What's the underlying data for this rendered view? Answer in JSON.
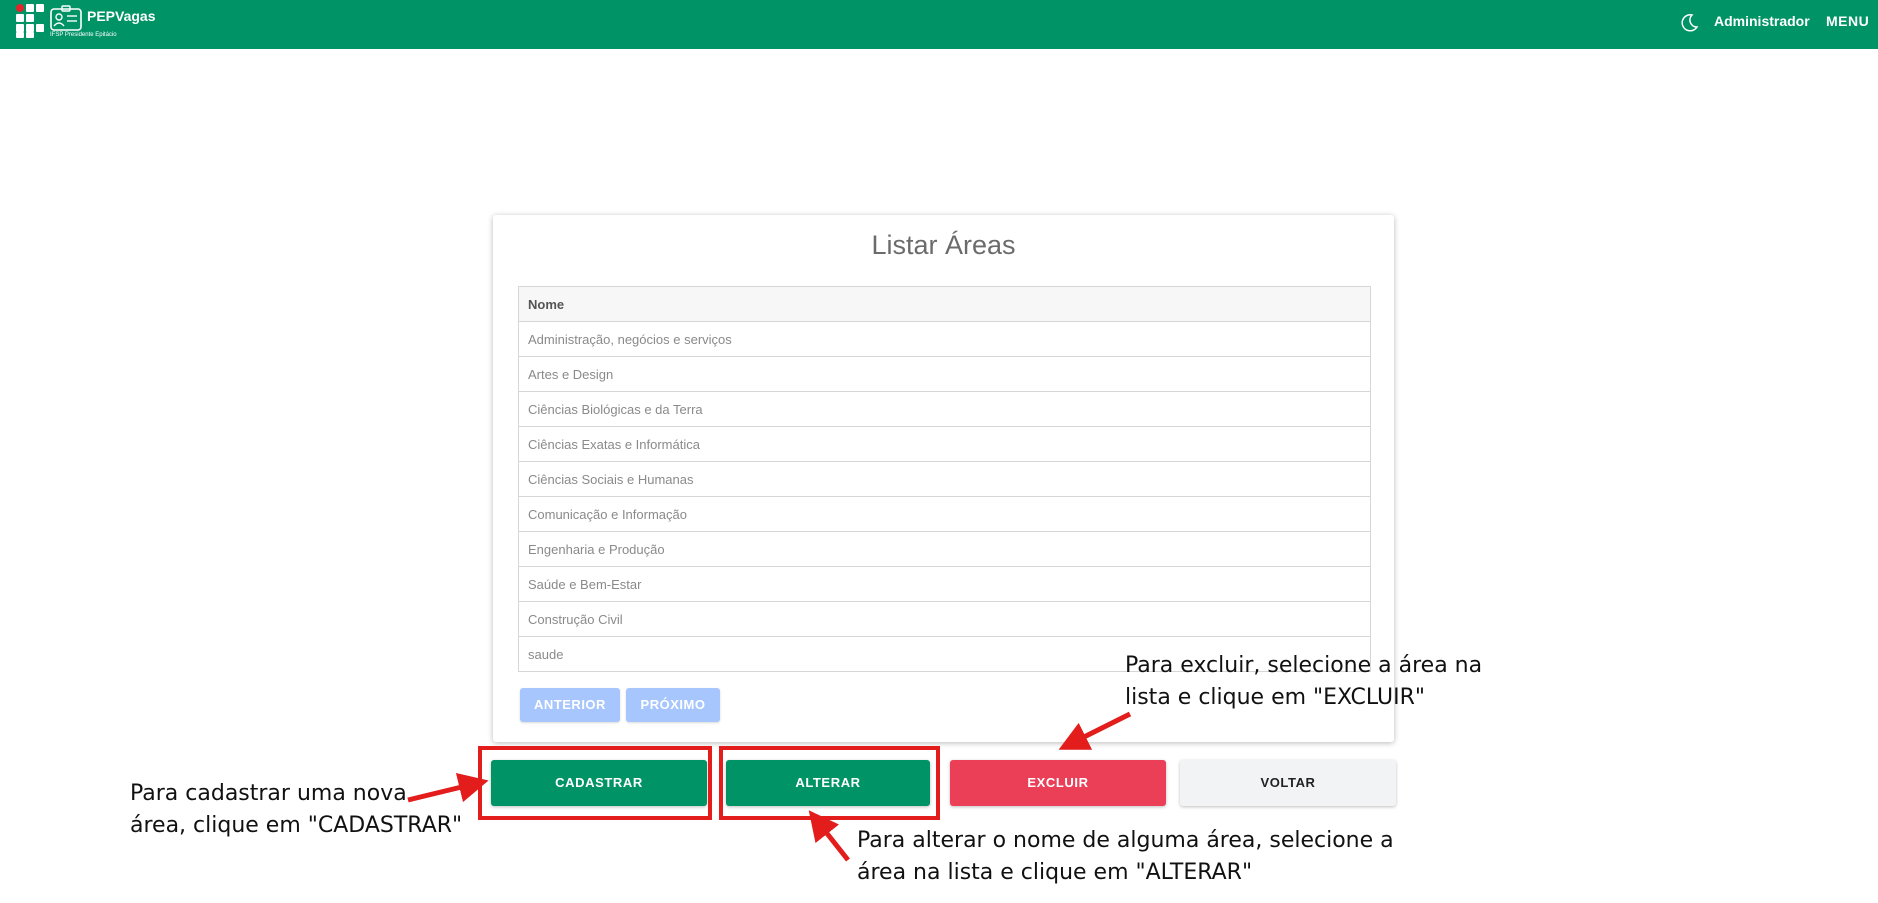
{
  "header": {
    "brand": "PEPVagas",
    "subtitle": "IFSP Presidente Epitácio",
    "user": "Administrador",
    "menu": "MENU",
    "icons": [
      "ifsp-logo-icon",
      "id-card-icon",
      "moon-icon"
    ]
  },
  "card": {
    "title": "Listar Áreas",
    "table": {
      "column": "Nome",
      "rows": [
        "Administração, negócios e serviços",
        "Artes e Design",
        "Ciências Biológicas e da Terra",
        "Ciências Exatas e Informática",
        "Ciências Sociais e Humanas",
        "Comunicação e Informação",
        "Engenharia e Produção",
        "Saúde e Bem-Estar",
        "Construção Civil",
        "saude"
      ]
    },
    "pager": {
      "prev": "ANTERIOR",
      "next": "PRÓXIMO"
    }
  },
  "actions": {
    "create": "CADASTRAR",
    "edit": "ALTERAR",
    "delete": "EXCLUIR",
    "back": "VOLTAR"
  },
  "annotations": {
    "delete_line1": "Para excluir, selecione a área na",
    "delete_line2": "lista e clique em \"EXCLUIR\"",
    "create_line1": "Para cadastrar uma nova",
    "create_line2": "área, clique em \"CADASTRAR\"",
    "edit_line1": "Para alterar o nome de alguma área, selecione a",
    "edit_line2": "área na lista e clique em \"ALTERAR\""
  },
  "colors": {
    "primary": "#009366",
    "danger": "#eb3e57",
    "disabled_pager": "#a6c6fd",
    "annotation": "#e31c1c"
  }
}
